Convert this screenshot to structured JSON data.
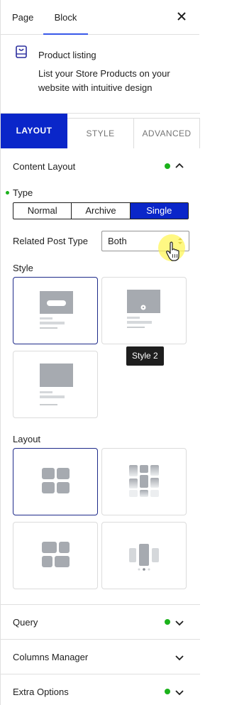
{
  "header": {
    "tabs": [
      {
        "label": "Page"
      },
      {
        "label": "Block"
      }
    ],
    "close_icon": "close-icon"
  },
  "block_card": {
    "icon": "product-box-icon",
    "title": "Product listing",
    "description": "List your Store Products on your website with intuitive design"
  },
  "settings_tabs": [
    {
      "label": "LAYOUT",
      "active": true
    },
    {
      "label": "STYLE",
      "active": false
    },
    {
      "label": "ADVANCED",
      "active": false
    }
  ],
  "content_layout": {
    "title": "Content Layout",
    "status_color": "#1bb21b",
    "expanded": true,
    "type": {
      "label": "Type",
      "options": [
        "Normal",
        "Archive",
        "Single"
      ],
      "selected": "Single"
    },
    "related_post_type": {
      "label": "Related Post Type",
      "value": "Both"
    },
    "style": {
      "label": "Style",
      "tooltip": "Style 2",
      "selected_index": 0
    },
    "layout": {
      "label": "Layout",
      "selected_index": 0
    }
  },
  "sections": [
    {
      "label": "Query",
      "has_dot": true
    },
    {
      "label": "Columns Manager",
      "has_dot": false
    },
    {
      "label": "Extra Options",
      "has_dot": true
    }
  ],
  "colors": {
    "accent": "#0a26c9",
    "tab_underline": "#3858e9",
    "status": "#1bb21b"
  }
}
